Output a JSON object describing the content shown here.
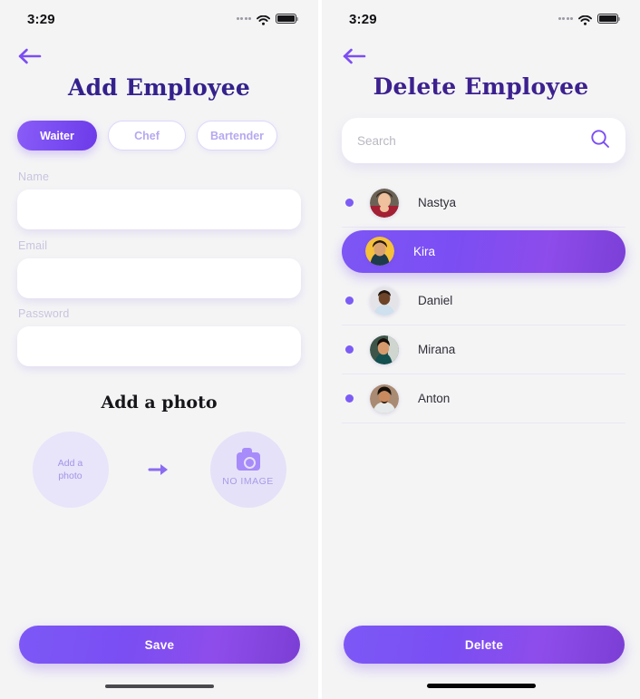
{
  "left_phone": {
    "status_bar": {
      "time": "3:29",
      "signal_icon": "signal-dots-icon",
      "wifi_icon": "wifi-icon",
      "battery_icon": "battery-full-icon"
    },
    "back_icon": "back-arrow-icon",
    "title": "Add Employee",
    "roles": [
      {
        "label": "Waiter",
        "selected": true
      },
      {
        "label": "Chef",
        "selected": false
      },
      {
        "label": "Bartender",
        "selected": false
      }
    ],
    "fields": [
      {
        "label": "Name",
        "value": "",
        "placeholder": ""
      },
      {
        "label": "Email",
        "value": "",
        "placeholder": ""
      },
      {
        "label": "Password",
        "value": "",
        "placeholder": ""
      }
    ],
    "photo": {
      "heading": "Add a photo",
      "add_line1": "Add a",
      "add_line2": "photo",
      "arrow_icon": "arrow-right-icon",
      "camera_icon": "camera-icon",
      "no_image_label": "NO IMAGE"
    },
    "save_label": "Save"
  },
  "right_phone": {
    "status_bar": {
      "time": "3:29",
      "signal_icon": "signal-dots-icon",
      "wifi_icon": "wifi-icon",
      "battery_icon": "battery-full-icon"
    },
    "back_icon": "back-arrow-icon",
    "title": "Delete Employee",
    "search": {
      "value": "",
      "placeholder": "Search",
      "icon": "search-icon"
    },
    "employees": [
      {
        "name": "Nastya",
        "selected": false
      },
      {
        "name": "Kira",
        "selected": true
      },
      {
        "name": "Daniel",
        "selected": false
      },
      {
        "name": "Mirana",
        "selected": false
      },
      {
        "name": "Anton",
        "selected": false
      }
    ],
    "delete_label": "Delete"
  },
  "colors": {
    "accent_purple": "#7c4ef3",
    "title_indigo": "#34218c",
    "screen_bg": "#f4f4f5",
    "field_label": "#c9c4de",
    "soft_lavender": "#e8e4fa"
  }
}
